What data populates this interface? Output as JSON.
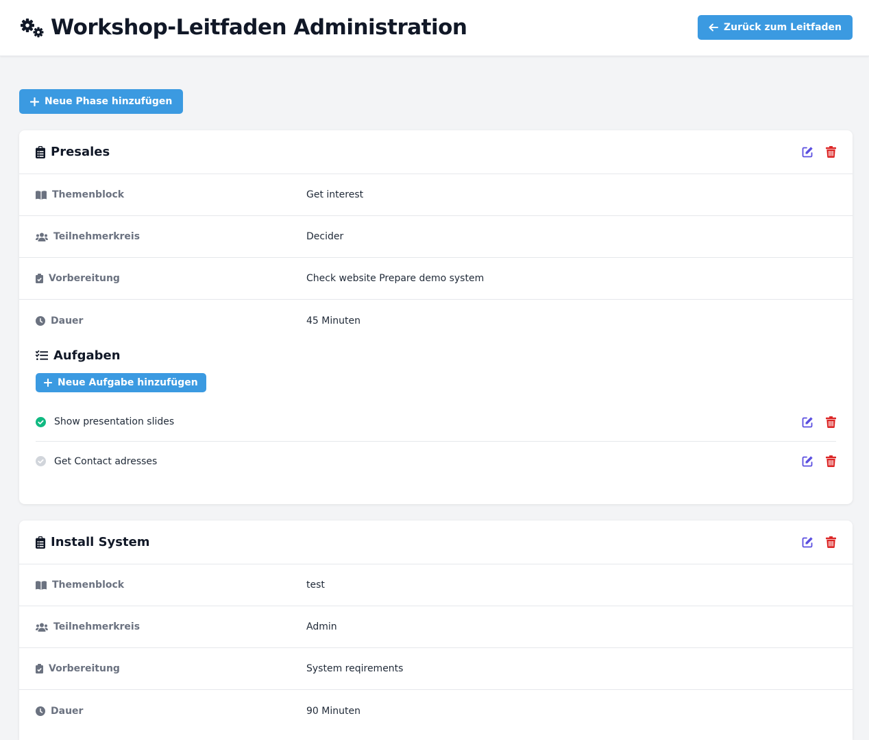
{
  "header": {
    "title": "Workshop-Leitfaden Administration",
    "back_label": "Zurück zum Leitfaden"
  },
  "toolbar": {
    "add_phase_label": "Neue Phase hinzufügen"
  },
  "labels": {
    "themenblock": "Themenblock",
    "teilnehmerkreis": "Teilnehmerkreis",
    "vorbereitung": "Vorbereitung",
    "dauer": "Dauer",
    "aufgaben": "Aufgaben",
    "add_task": "Neue Aufgabe hinzufügen"
  },
  "phases": [
    {
      "title": "Presales",
      "themenblock": "Get interest",
      "teilnehmerkreis": "Decider",
      "vorbereitung": "Check website Prepare demo system",
      "dauer": "45 Minuten",
      "tasks": [
        {
          "label": "Show presentation slides",
          "done": true
        },
        {
          "label": "Get Contact adresses",
          "done": false
        }
      ]
    },
    {
      "title": "Install System",
      "themenblock": "test",
      "teilnehmerkreis": "Admin",
      "vorbereitung": "System reqirements",
      "dauer": "90 Minuten"
    }
  ],
  "colors": {
    "primary": "#3b9ae1",
    "edit": "#5b4fe0",
    "delete": "#dc2626",
    "done": "#10b981",
    "pending": "#d1d5db"
  }
}
